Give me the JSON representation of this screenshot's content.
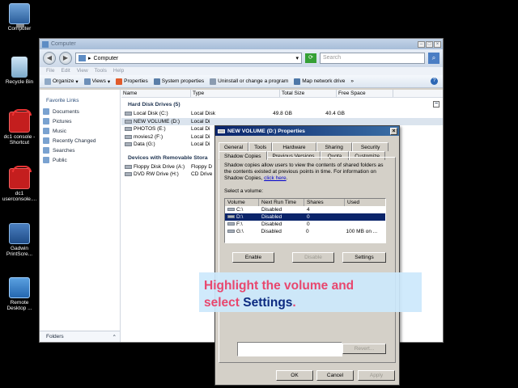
{
  "desktop": {
    "icons": [
      {
        "label": "Computer",
        "icon": "computer-icon"
      },
      {
        "label": "Recycle Bin",
        "icon": "recycle-bin-icon"
      },
      {
        "label": "dc1 console - Shortcut",
        "icon": "toolbox-icon"
      },
      {
        "label": "dc1 userconsole....",
        "icon": "toolbox-icon"
      },
      {
        "label": "Gadwin PrintScre...",
        "icon": "camera-icon"
      },
      {
        "label": "Remote Desktop ...",
        "icon": "remote-desktop-icon"
      }
    ]
  },
  "explorer": {
    "title": "Computer",
    "address": "Computer",
    "search_placeholder": "Search",
    "menu": [
      "File",
      "Edit",
      "View",
      "Tools",
      "Help"
    ],
    "toolbar": [
      "Organize",
      "Views",
      "Properties",
      "System properties",
      "Uninstall or change a program",
      "Map network drive",
      "»"
    ],
    "favorites_head": "Favorite Links",
    "favorites": [
      "Documents",
      "Pictures",
      "Music",
      "Recently Changed",
      "Searches",
      "Public"
    ],
    "folders_label": "Folders",
    "columns": [
      "Name",
      "Type",
      "Total Size",
      "Free Space"
    ],
    "hdd_group": "Hard Disk Drives (5)",
    "hdd": [
      {
        "name": "Local Disk (C:)",
        "type": "Local Disk",
        "total": "49.8 GB",
        "free": "40.4 GB"
      },
      {
        "name": "NEW VOLUME (D:)",
        "type": "Local Di"
      },
      {
        "name": "PHOTOS (E:)",
        "type": "Local Di"
      },
      {
        "name": "movies2 (F:)",
        "type": "Local Di"
      },
      {
        "name": "Data (G:)",
        "type": "Local Di"
      }
    ],
    "removable_group": "Devices with Removable Stora",
    "removable": [
      {
        "name": "Floppy Disk Drive (A:)",
        "type": "Floppy D"
      },
      {
        "name": "DVD RW Drive (H:)",
        "type": "CD Drive"
      }
    ]
  },
  "dialog": {
    "title": "NEW VOLUME (D:) Properties",
    "tabs_row1": [
      "General",
      "Tools",
      "Hardware",
      "Sharing",
      "Security"
    ],
    "tabs_row2": [
      "Shadow Copies",
      "Previous Versions",
      "Quota",
      "Customize"
    ],
    "description": "Shadow copies allow users to view the contents of shared folders as the contents existed at previous points in time. For information on Shadow Copies,",
    "link": "click here",
    "select_label": "Select a volume:",
    "vol_columns": [
      "Volume",
      "Next Run Time",
      "Shares",
      "Used"
    ],
    "volumes": [
      {
        "volume": "C:\\",
        "next": "Disabled",
        "shares": "4",
        "used": ""
      },
      {
        "volume": "D:\\",
        "next": "Disabled",
        "shares": "0",
        "used": ""
      },
      {
        "volume": "F:\\",
        "next": "Disabled",
        "shares": "0",
        "used": ""
      },
      {
        "volume": "G:\\",
        "next": "Disabled",
        "shares": "0",
        "used": "100 MB on ..."
      }
    ],
    "enable": "Enable",
    "disable": "Disable",
    "settings": "Settings",
    "revert": "Revert...",
    "ok": "OK",
    "cancel": "Cancel",
    "apply": "Apply"
  },
  "callout": {
    "line1": "Highlight the volume and",
    "line2_pre": "select ",
    "line2_hl": "Settings",
    "line2_post": "."
  }
}
